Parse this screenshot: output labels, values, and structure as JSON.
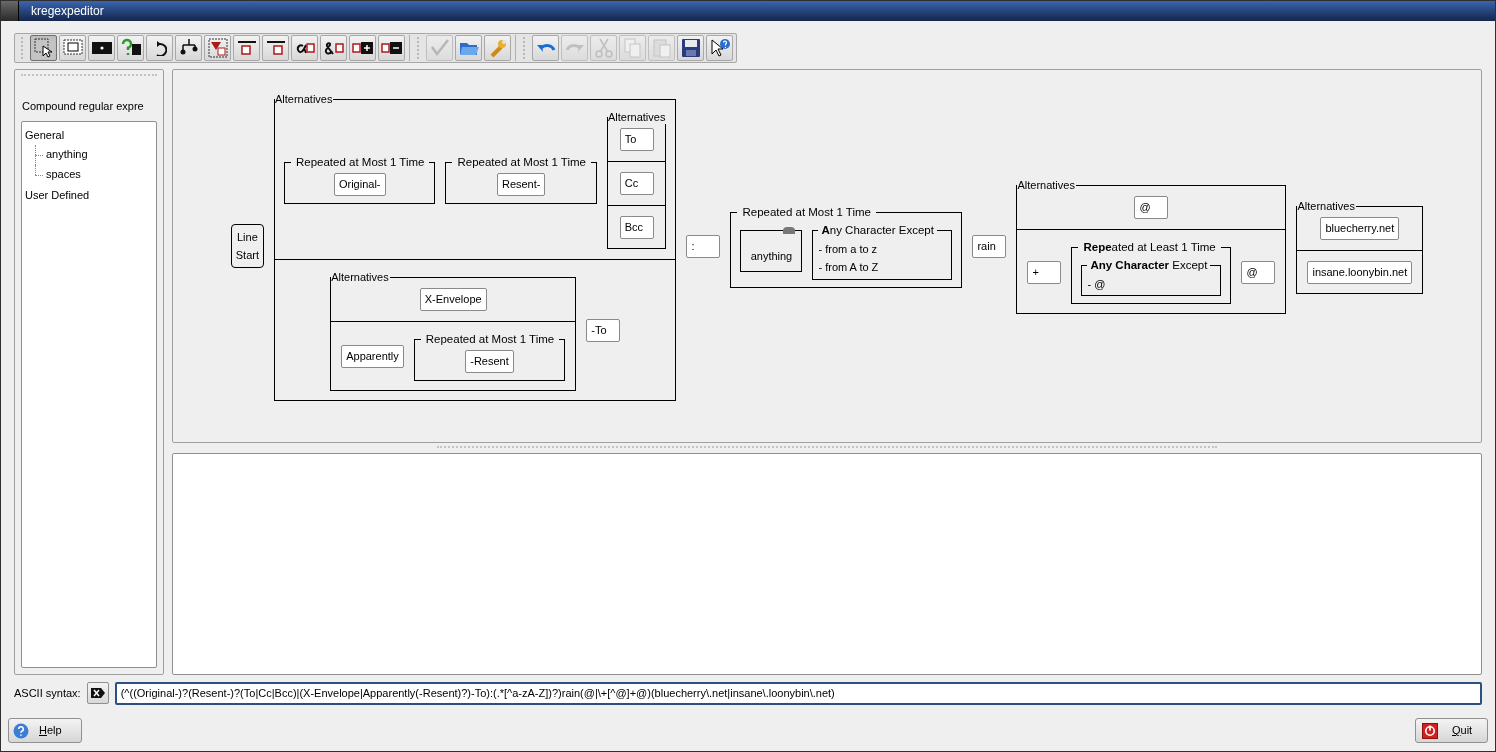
{
  "window": {
    "title": "kregexpeditor"
  },
  "toolbar": [
    {
      "kind": "select",
      "selected": true,
      "disabled": false
    },
    {
      "kind": "text",
      "selected": false,
      "disabled": false
    },
    {
      "kind": "anychar",
      "selected": false,
      "disabled": false
    },
    {
      "kind": "question",
      "selected": false,
      "disabled": false
    },
    {
      "kind": "repeat",
      "selected": false,
      "disabled": false
    },
    {
      "kind": "alternatives",
      "selected": false,
      "disabled": false
    },
    {
      "kind": "compound",
      "selected": false,
      "disabled": false
    },
    {
      "kind": "linestart",
      "selected": false,
      "disabled": false
    },
    {
      "kind": "lineend",
      "selected": false,
      "disabled": false
    },
    {
      "kind": "wordboundary",
      "selected": false,
      "disabled": false
    },
    {
      "kind": "nonwordboundary",
      "selected": false,
      "disabled": false
    },
    {
      "kind": "lookahead",
      "selected": false,
      "disabled": false
    },
    {
      "kind": "neglookahead",
      "selected": false,
      "disabled": false
    },
    {
      "kind": "sep"
    },
    {
      "kind": "verify",
      "selected": false,
      "disabled": true
    },
    {
      "kind": "open",
      "selected": false,
      "disabled": false
    },
    {
      "kind": "wrench",
      "selected": false,
      "disabled": false
    },
    {
      "kind": "sep"
    },
    {
      "kind": "undo",
      "selected": false,
      "disabled": false
    },
    {
      "kind": "redo",
      "selected": false,
      "disabled": true
    },
    {
      "kind": "cut",
      "selected": false,
      "disabled": true
    },
    {
      "kind": "copy",
      "selected": false,
      "disabled": true
    },
    {
      "kind": "paste",
      "selected": false,
      "disabled": true
    },
    {
      "kind": "save",
      "selected": false,
      "disabled": false
    },
    {
      "kind": "whatsthis",
      "selected": false,
      "disabled": false
    }
  ],
  "sidebar": {
    "title": "Compound regular expre",
    "tree": [
      {
        "label": "General",
        "children": [
          {
            "label": "anything"
          },
          {
            "label": "spaces"
          }
        ]
      },
      {
        "label": "User Defined"
      }
    ]
  },
  "diagram": {
    "kind": "sequence",
    "children": [
      {
        "kind": "anchor",
        "lines": [
          "Line",
          "Start"
        ]
      },
      {
        "kind": "alternatives",
        "label": "Alternatives",
        "children": [
          {
            "kind": "sequence",
            "children": [
              {
                "kind": "repeat",
                "label": "Repeated at Most 1 Time",
                "child": {
                  "kind": "text",
                  "text": "Original-"
                }
              },
              {
                "kind": "repeat",
                "label": "Repeated at Most 1 Time",
                "child": {
                  "kind": "text",
                  "text": "Resent-"
                }
              },
              {
                "kind": "alternatives",
                "label": "Alternatives",
                "children": [
                  {
                    "kind": "text",
                    "text": "To"
                  },
                  {
                    "kind": "text",
                    "text": "Cc"
                  },
                  {
                    "kind": "text",
                    "text": "Bcc"
                  }
                ]
              }
            ]
          },
          {
            "kind": "sequence",
            "children": [
              {
                "kind": "alternatives",
                "label": "Alternatives",
                "children": [
                  {
                    "kind": "text",
                    "text": "X-Envelope"
                  },
                  {
                    "kind": "sequence",
                    "children": [
                      {
                        "kind": "text",
                        "text": "Apparently"
                      },
                      {
                        "kind": "repeat",
                        "label": "Repeated at Most 1 Time",
                        "child": {
                          "kind": "text",
                          "text": "-Resent"
                        }
                      }
                    ]
                  }
                ]
              },
              {
                "kind": "text",
                "text": "-To"
              }
            ]
          }
        ]
      },
      {
        "kind": "text",
        "text": ":"
      },
      {
        "kind": "repeat",
        "label": "Repeated at Most 1 Time",
        "child": {
          "kind": "sequence",
          "children": [
            {
              "kind": "compound",
              "text": "anything"
            },
            {
              "kind": "charset",
              "label": "**A**ny Character Except",
              "items": [
                "- from a to z",
                "- from A to Z"
              ]
            }
          ]
        }
      },
      {
        "kind": "text",
        "text": "rain"
      },
      {
        "kind": "alternatives",
        "label": "Alternatives",
        "children": [
          {
            "kind": "text",
            "text": "@"
          },
          {
            "kind": "sequence",
            "children": [
              {
                "kind": "text",
                "text": "+"
              },
              {
                "kind": "repeat",
                "label": "**Repe**ated at Least 1 Time",
                "child": {
                  "kind": "charset",
                  "label": "**Any Character** Except",
                  "items": [
                    "- @"
                  ]
                }
              },
              {
                "kind": "text",
                "text": "@"
              }
            ]
          }
        ]
      },
      {
        "kind": "alternatives",
        "label": "Alternatives",
        "children": [
          {
            "kind": "text",
            "text": "bluecherry.net"
          },
          {
            "kind": "text",
            "text": "insane.loonybin.net"
          }
        ]
      }
    ]
  },
  "ascii": {
    "label": "ASCII syntax:",
    "value": "(^((Original-)?(Resent-)?(To|Cc|Bcc)|(X-Envelope|Apparently(-Resent)?)-To):(.*[^a-zA-Z])?)rain(@|\\+[^@]+@)(bluecherry\\.net|insane\\.loonybin\\.net)"
  },
  "buttons": {
    "help": "Help",
    "quit": "Quit"
  }
}
